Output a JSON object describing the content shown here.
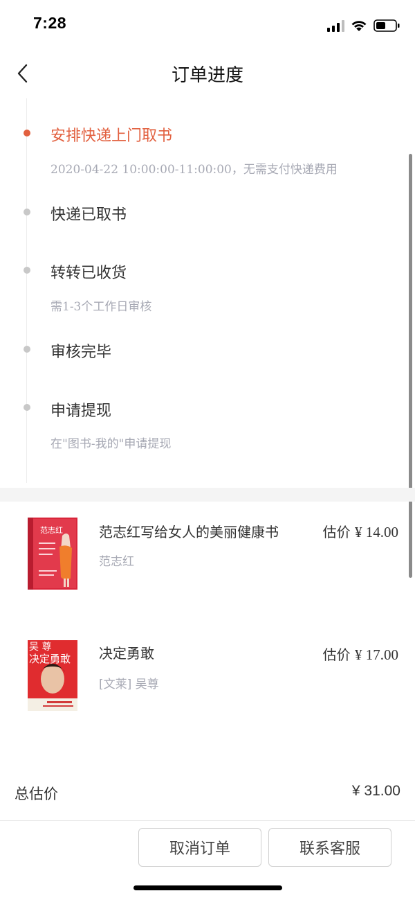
{
  "status_bar": {
    "time": "7:28"
  },
  "nav": {
    "title": "订单进度"
  },
  "timeline": [
    {
      "title": "安排快递上门取书",
      "desc": "2020-04-22 10:00:00-11:00:00，无需支付快递费用",
      "active": true
    },
    {
      "title": "快递已取书",
      "desc": ""
    },
    {
      "title": "转转已收货",
      "desc": "需1-3个工作日审核"
    },
    {
      "title": "审核完毕",
      "desc": ""
    },
    {
      "title": "申请提现",
      "desc": "在\"图书-我的\"申请提现"
    }
  ],
  "books": [
    {
      "title": "范志红写给女人的美丽健康书",
      "author": "范志红",
      "price_label": "估价",
      "price": "¥ 14.00",
      "cover": {
        "text_top": "范志红",
        "text_side": "写给女人的美丽健康书",
        "color": "#d9253a"
      }
    },
    {
      "title": "决定勇敢",
      "author": "[文莱] 吴尊",
      "price_label": "估价",
      "price": "¥ 17.00",
      "cover": {
        "text_top": "吴 尊",
        "text_main": "决定勇敢",
        "color": "#e02c2f"
      }
    }
  ],
  "total": {
    "label": "总估价",
    "value": "¥ 31.00"
  },
  "actions": {
    "cancel": "取消订单",
    "contact": "联系客服"
  },
  "colors": {
    "accent": "#e2603f",
    "muted": "#a7a9b4",
    "dot": "#c8c8c8"
  }
}
